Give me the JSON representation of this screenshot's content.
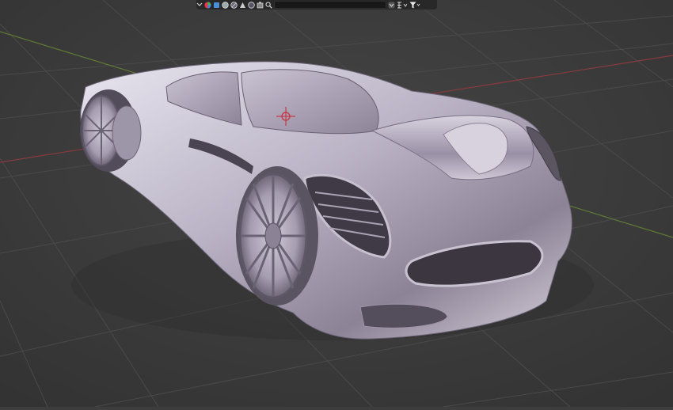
{
  "app": {
    "name": "3D viewport"
  },
  "toolbar": {
    "search": {
      "value": "",
      "placeholder": ""
    },
    "icons": [
      "dropdown-chevron-icon",
      "shading-color-icon",
      "object-type-cube-icon",
      "filter-mesh-icon",
      "filter-light-icon",
      "filter-camera-icon",
      "filter-empty-icon",
      "filter-other-icon",
      "search-icon",
      "collapse-icon",
      "restrict-toggles-icon",
      "filter-funnel-icon"
    ]
  },
  "viewport": {
    "grid": true,
    "x_axis_color": "#8a3a3f",
    "y_axis_color": "#5f7a35",
    "background_color": "#3d3d3d",
    "object": "sports-car-model",
    "origin_marker": "object-origin-cursor"
  }
}
